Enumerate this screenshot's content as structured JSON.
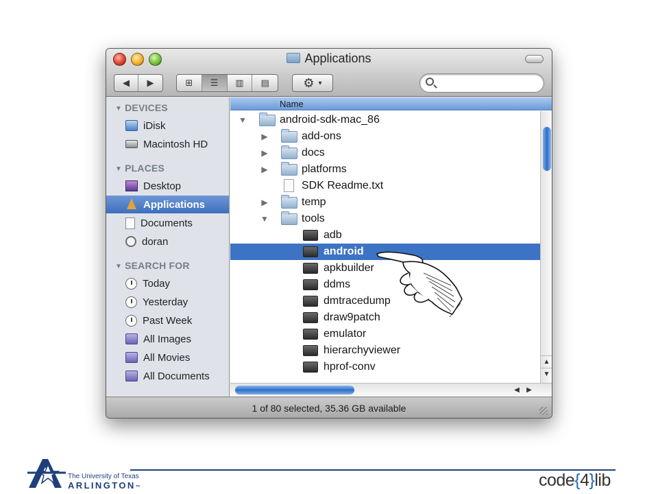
{
  "window": {
    "title": "Applications",
    "search_placeholder": "",
    "status": "1 of 80 selected, 35.36 GB available"
  },
  "toolbar": {
    "nav": [
      {
        "icon": "back-arrow-icon",
        "glyph": "◀"
      },
      {
        "icon": "forward-arrow-icon",
        "glyph": "▶"
      }
    ],
    "views": [
      {
        "icon": "icon-view-icon",
        "glyph": "⊞",
        "active": false
      },
      {
        "icon": "list-view-icon",
        "glyph": "☰",
        "active": true
      },
      {
        "icon": "column-view-icon",
        "glyph": "▥",
        "active": false
      },
      {
        "icon": "coverflow-view-icon",
        "glyph": "▤",
        "active": false
      }
    ],
    "action_glyph": "⚙",
    "action_caret": "▾"
  },
  "sidebar": {
    "sections": [
      {
        "title": "DEVICES",
        "items": [
          {
            "label": "iDisk",
            "icon": "idisk-icon",
            "selected": false
          },
          {
            "label": "Macintosh HD",
            "icon": "hard-drive-icon",
            "selected": false
          }
        ]
      },
      {
        "title": "PLACES",
        "items": [
          {
            "label": "Desktop",
            "icon": "desktop-icon",
            "selected": false
          },
          {
            "label": "Applications",
            "icon": "applications-icon",
            "selected": true
          },
          {
            "label": "Documents",
            "icon": "documents-icon",
            "selected": false
          },
          {
            "label": "doran",
            "icon": "home-icon",
            "selected": false
          }
        ]
      },
      {
        "title": "SEARCH FOR",
        "items": [
          {
            "label": "Today",
            "icon": "clock-icon",
            "selected": false
          },
          {
            "label": "Yesterday",
            "icon": "clock-icon",
            "selected": false
          },
          {
            "label": "Past Week",
            "icon": "clock-icon",
            "selected": false
          },
          {
            "label": "All Images",
            "icon": "smart-folder-icon",
            "selected": false
          },
          {
            "label": "All Movies",
            "icon": "smart-folder-icon",
            "selected": false
          },
          {
            "label": "All Documents",
            "icon": "smart-folder-icon",
            "selected": false
          }
        ]
      }
    ]
  },
  "list": {
    "column_name": "Name",
    "rows": [
      {
        "name": "android-sdk-mac_86",
        "level": 0,
        "kind": "folder",
        "disclosure": "open",
        "selected": false
      },
      {
        "name": "add-ons",
        "level": 1,
        "kind": "folder",
        "disclosure": "closed",
        "selected": false
      },
      {
        "name": "docs",
        "level": 1,
        "kind": "folder",
        "disclosure": "closed",
        "selected": false
      },
      {
        "name": "platforms",
        "level": 1,
        "kind": "folder",
        "disclosure": "closed",
        "selected": false
      },
      {
        "name": "SDK Readme.txt",
        "level": 1,
        "kind": "text",
        "disclosure": "none",
        "selected": false
      },
      {
        "name": "temp",
        "level": 1,
        "kind": "folder",
        "disclosure": "closed",
        "selected": false
      },
      {
        "name": "tools",
        "level": 1,
        "kind": "folder",
        "disclosure": "open",
        "selected": false
      },
      {
        "name": "adb",
        "level": 2,
        "kind": "exec",
        "disclosure": "none",
        "selected": false
      },
      {
        "name": "android",
        "level": 2,
        "kind": "exec",
        "disclosure": "none",
        "selected": true
      },
      {
        "name": "apkbuilder",
        "level": 2,
        "kind": "exec",
        "disclosure": "none",
        "selected": false
      },
      {
        "name": "ddms",
        "level": 2,
        "kind": "exec",
        "disclosure": "none",
        "selected": false
      },
      {
        "name": "dmtracedump",
        "level": 2,
        "kind": "exec",
        "disclosure": "none",
        "selected": false
      },
      {
        "name": "draw9patch",
        "level": 2,
        "kind": "exec",
        "disclosure": "none",
        "selected": false
      },
      {
        "name": "emulator",
        "level": 2,
        "kind": "exec",
        "disclosure": "none",
        "selected": false
      },
      {
        "name": "hierarchyviewer",
        "level": 2,
        "kind": "exec",
        "disclosure": "none",
        "selected": false
      },
      {
        "name": "hprof-conv",
        "level": 2,
        "kind": "exec",
        "disclosure": "none",
        "selected": false
      }
    ]
  },
  "footer": {
    "uta_line1": "The University of Texas",
    "uta_line2": "ARLINGTON",
    "uta_tm": "™",
    "c4l_left": "code",
    "c4l_brace_open": "{",
    "c4l_num": "4",
    "c4l_brace_close": "}",
    "c4l_right": "lib"
  },
  "colors": {
    "selection": "#3d73c5",
    "sidebar_bg": "#dfe3e9",
    "footer_blue": "#1f3f7a"
  }
}
